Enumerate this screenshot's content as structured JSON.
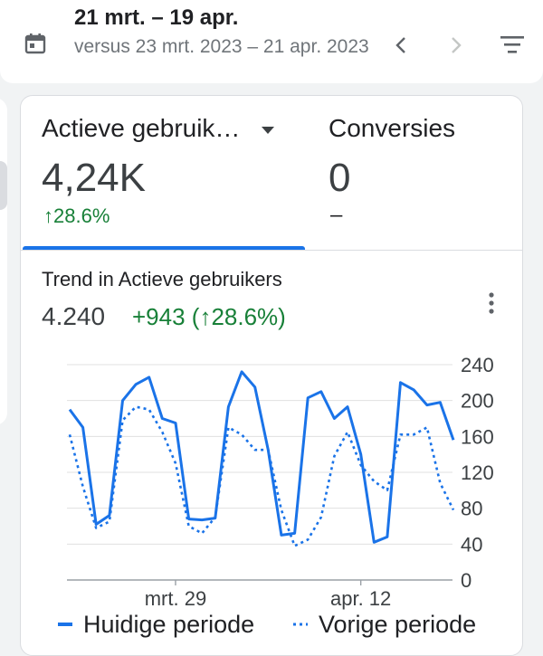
{
  "date_range": {
    "main": "21 mrt. – 19 apr.",
    "compare": "versus 23 mrt. 2023 – 21 apr. 2023"
  },
  "icons": [
    "calendar-icon",
    "chevron-left-icon",
    "chevron-right-icon",
    "filter-icon",
    "dropdown-arrow-icon",
    "more-vert-icon"
  ],
  "metrics": [
    {
      "label": "Actieve gebruik…",
      "value": "4,24K",
      "change": "↑28.6%"
    },
    {
      "label": "Conversies",
      "value": "0",
      "change": "–"
    }
  ],
  "trend": {
    "title": "Trend in Actieve gebruikers",
    "total": "4.240",
    "delta": "+943 (↑28.6%)"
  },
  "colors": {
    "accent": "#1a73e8",
    "positive": "#188038",
    "muted": "#70757a"
  },
  "chart_data": {
    "type": "line",
    "x_tick_labels": [
      "mrt. 29",
      "apr. 12"
    ],
    "y_ticks": [
      0,
      40,
      80,
      120,
      160,
      200,
      240
    ],
    "ylim": [
      0,
      240
    ],
    "grid": true,
    "legend_position": "bottom",
    "series": [
      {
        "name": "Huidige periode",
        "style": "solid",
        "values": [
          190,
          170,
          62,
          72,
          200,
          218,
          226,
          180,
          175,
          68,
          67,
          69,
          193,
          232,
          215,
          145,
          50,
          52,
          203,
          210,
          180,
          193,
          140,
          42,
          48,
          220,
          212,
          195,
          198,
          156
        ]
      },
      {
        "name": "Vorige periode",
        "style": "dotted",
        "values": [
          162,
          104,
          58,
          65,
          178,
          193,
          190,
          165,
          130,
          60,
          52,
          70,
          170,
          162,
          145,
          145,
          78,
          38,
          45,
          70,
          138,
          165,
          128,
          110,
          100,
          162,
          162,
          170,
          108,
          78
        ]
      }
    ]
  }
}
